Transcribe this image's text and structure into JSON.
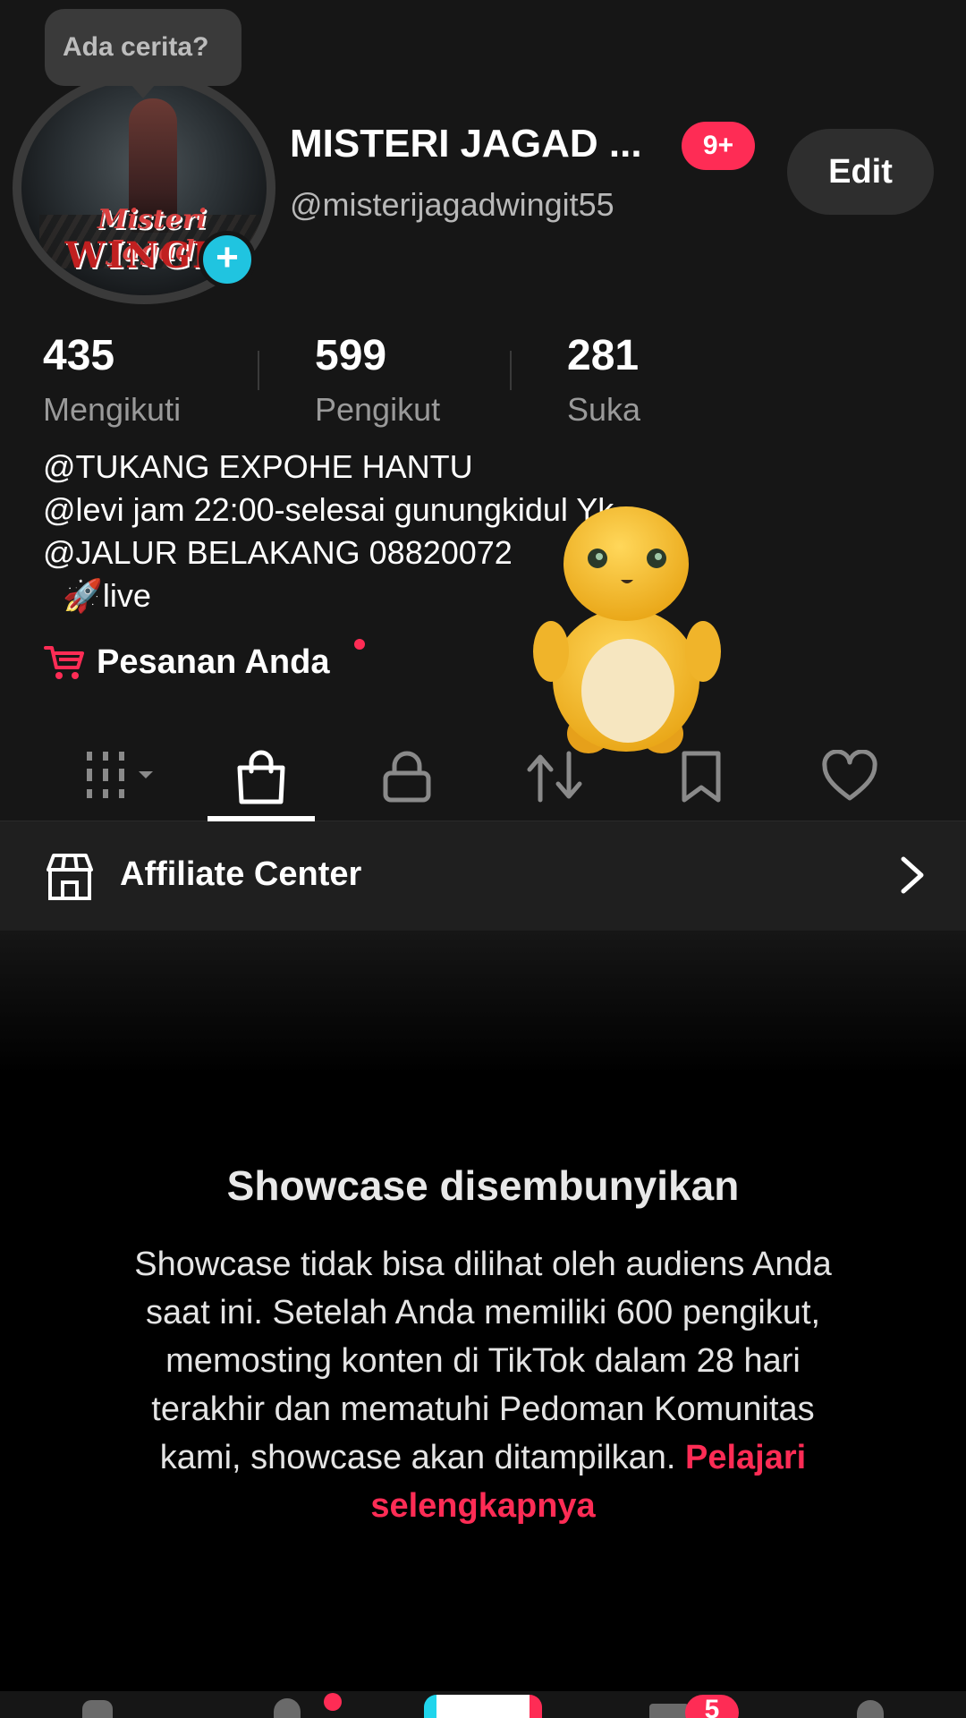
{
  "profile": {
    "story_prompt": "Ada cerita?",
    "avatar_logo_line1": "Misteri Jagad",
    "avatar_logo_line2": "WINGIT",
    "add_story_symbol": "+",
    "name": "MISTERI JAGAD ...",
    "notification_badge": "9+",
    "handle": "@misterijagadwingit55",
    "edit_label": "Edit"
  },
  "stats": [
    {
      "value": "435",
      "label": "Mengikuti"
    },
    {
      "value": "599",
      "label": "Pengikut"
    },
    {
      "value": "281",
      "label": "Suka"
    }
  ],
  "bio": [
    "@TUKANG EXPOHE HANTU",
    "@levi jam 22:00-selesai gunungkidul Yk",
    "@JALUR BELAKANG 08820072",
    "🚀live"
  ],
  "orders": {
    "label": "Pesanan Anda",
    "icon": "cart-icon"
  },
  "tabs": [
    {
      "icon": "grid-icon",
      "selected": false
    },
    {
      "icon": "shopping-bag-icon",
      "selected": true
    },
    {
      "icon": "lock-icon",
      "selected": false
    },
    {
      "icon": "repost-icon",
      "selected": false
    },
    {
      "icon": "bookmark-icon",
      "selected": false
    },
    {
      "icon": "heart-icon",
      "selected": false
    }
  ],
  "affiliate": {
    "label": "Affiliate Center",
    "icon": "store-icon"
  },
  "showcase": {
    "title": "Showcase disembunyikan",
    "body": "Showcase tidak bisa dilihat oleh audiens Anda saat ini. Setelah Anda memiliki 600 pengikut, memosting konten di TikTok dalam 28 hari terakhir dan mematuhi Pedoman Komunitas kami, showcase akan ditampilkan.",
    "link": "Pelajari selengkapnya"
  },
  "bottom_nav": {
    "inbox_badge": "5"
  },
  "colors": {
    "accent": "#fe2c55",
    "story_plus": "#20c4e0",
    "background": "#161616"
  }
}
